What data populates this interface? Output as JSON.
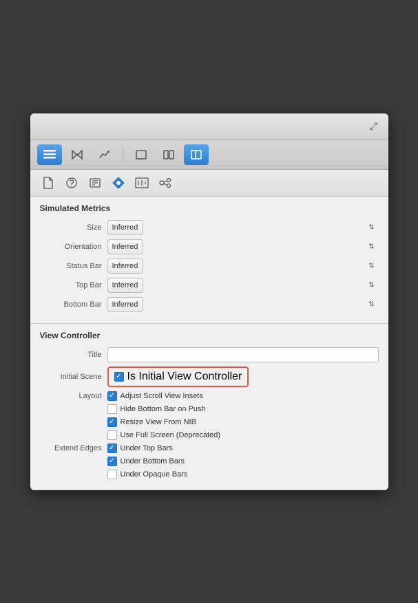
{
  "toolbar1": {
    "icons": [
      "list-icon",
      "tie-icon",
      "graph-icon"
    ],
    "icons2": [
      "rect-icon",
      "split-h-icon",
      "sidebar-icon"
    ],
    "active": 2,
    "collapseLabel": "⤢"
  },
  "toolbar2": {
    "tabs": [
      {
        "name": "file-tab",
        "icon": "📄",
        "active": false
      },
      {
        "name": "wave-tab",
        "icon": "≋",
        "active": false
      },
      {
        "name": "grid-tab",
        "icon": "▦",
        "active": false
      },
      {
        "name": "pin-tab",
        "icon": "◈",
        "active": true
      },
      {
        "name": "ruler-tab",
        "icon": "📏",
        "active": false
      },
      {
        "name": "arrow-tab",
        "icon": "➤",
        "active": false
      }
    ]
  },
  "simulated_metrics": {
    "title": "Simulated Metrics",
    "rows": [
      {
        "label": "Size",
        "value": "Inferred",
        "name": "size-select"
      },
      {
        "label": "Orientation",
        "value": "Inferred",
        "name": "orientation-select"
      },
      {
        "label": "Status Bar",
        "value": "Inferred",
        "name": "status-bar-select"
      },
      {
        "label": "Top Bar",
        "value": "Inferred",
        "name": "top-bar-select"
      },
      {
        "label": "Bottom Bar",
        "value": "Inferred",
        "name": "bottom-bar-select"
      }
    ]
  },
  "view_controller": {
    "title": "View Controller",
    "title_label": "Title",
    "title_placeholder": "",
    "initial_scene_label": "Initial Scene",
    "initial_scene_checkbox_label": "Is Initial View Controller",
    "layout_label": "Layout",
    "layout_checkboxes": [
      {
        "label": "Adjust Scroll View Insets",
        "checked": true,
        "name": "adjust-scroll-cb"
      },
      {
        "label": "Hide Bottom Bar on Push",
        "checked": false,
        "name": "hide-bottom-cb"
      },
      {
        "label": "Resize View From NIB",
        "checked": true,
        "name": "resize-view-cb"
      },
      {
        "label": "Use Full Screen (Deprecated)",
        "checked": false,
        "name": "full-screen-cb"
      }
    ],
    "extend_edges_label": "Extend Edges",
    "extend_checkboxes": [
      {
        "label": "Under Top Bars",
        "checked": true,
        "name": "under-top-cb"
      },
      {
        "label": "Under Bottom Bars",
        "checked": true,
        "name": "under-bottom-cb"
      },
      {
        "label": "Under Opaque Bars",
        "checked": false,
        "name": "under-opaque-cb"
      }
    ]
  }
}
